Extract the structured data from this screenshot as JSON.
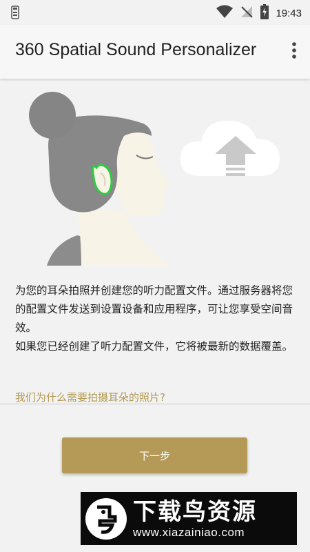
{
  "status_bar": {
    "time": "19:43",
    "icons": [
      "sim-card-icon",
      "wifi-icon",
      "no-signal-icon",
      "battery-charging-icon"
    ]
  },
  "app_bar": {
    "title": "360 Spatial Sound Personalizer",
    "menu_icon": "more-vert-icon"
  },
  "hero": {
    "illustration": "woman-head-ear-highlight",
    "cloud_icon": "cloud-upload-icon",
    "ear_highlight_color": "#2ecc40"
  },
  "body": {
    "paragraph1": "为您的耳朵拍照并创建您的听力配置文件。通过服务器将您的配置文件发送到设置设备和应用程序，可让您享受空间音效。",
    "paragraph2": "如果您已经创建了听力配置文件，它将被最新的数据覆盖。",
    "link": "我们为什么需要拍摄耳朵的照片?"
  },
  "actions": {
    "next_label": "下一步"
  },
  "watermark": {
    "title": "下载鸟资源",
    "url": "www.xiazainiao.com"
  },
  "colors": {
    "accent": "#b49a56",
    "link": "#b29a53",
    "background": "#f2f2f2"
  }
}
